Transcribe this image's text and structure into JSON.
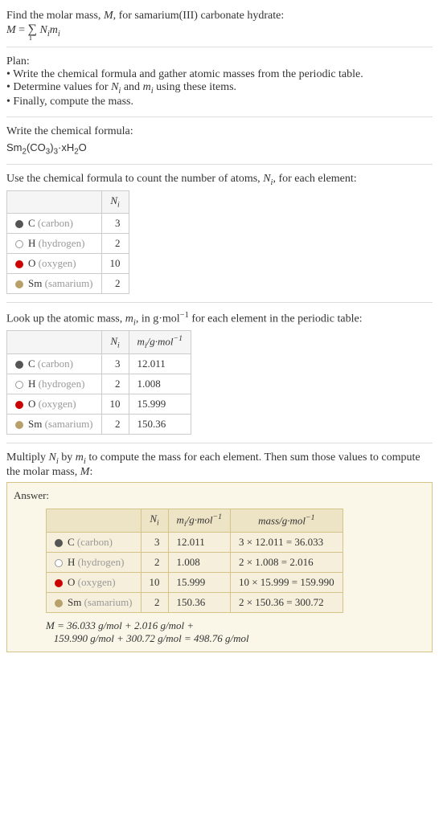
{
  "intro": {
    "line1_part1": "Find the molar mass, ",
    "line1_M": "M",
    "line1_part2": ", for samarium(III) carbonate hydrate:",
    "formula_M": "M",
    "formula_eq": " = ",
    "formula_sum": "∑",
    "formula_sub_i": "i",
    "formula_Ni": "N",
    "formula_Ni_sub": "i",
    "formula_mi": "m",
    "formula_mi_sub": "i"
  },
  "plan": {
    "heading": "Plan:",
    "bullet1": "• Write the chemical formula and gather atomic masses from the periodic table.",
    "bullet2_part1": "• Determine values for ",
    "bullet2_Ni": "N",
    "bullet2_Ni_sub": "i",
    "bullet2_and": " and ",
    "bullet2_mi": "m",
    "bullet2_mi_sub": "i",
    "bullet2_part2": " using these items.",
    "bullet3": "• Finally, compute the mass."
  },
  "formula_section": {
    "heading": "Write the chemical formula:",
    "sm": "Sm",
    "sm_sub": "2",
    "co": "(CO",
    "co_sub3": "3",
    "paren": ")",
    "paren_sub": "3",
    "dot": "·xH",
    "h_sub": "2",
    "o": "O"
  },
  "count_section": {
    "heading_part1": "Use the chemical formula to count the number of atoms, ",
    "heading_Ni": "N",
    "heading_Ni_sub": "i",
    "heading_part2": ", for each element:",
    "header_Ni": "N",
    "header_Ni_sub": "i"
  },
  "elements": [
    {
      "symbol": "C",
      "name": " (carbon)",
      "color": "#555",
      "N": "3",
      "m": "12.011",
      "mass": "3 × 12.011 = 36.033"
    },
    {
      "symbol": "H",
      "name": " (hydrogen)",
      "color": "#fff",
      "border": "#999",
      "N": "2",
      "m": "1.008",
      "mass": "2 × 1.008 = 2.016"
    },
    {
      "symbol": "O",
      "name": " (oxygen)",
      "color": "#c00",
      "N": "10",
      "m": "15.999",
      "mass": "10 × 15.999 = 159.990"
    },
    {
      "symbol": "Sm",
      "name": " (samarium)",
      "color": "#b8a06a",
      "N": "2",
      "m": "150.36",
      "mass": "2 × 150.36 = 300.72"
    }
  ],
  "lookup_section": {
    "heading_part1": "Look up the atomic mass, ",
    "heading_mi": "m",
    "heading_mi_sub": "i",
    "heading_part2": ", in g·mol",
    "heading_sup": "−1",
    "heading_part3": " for each element in the periodic table:",
    "header_mi": "m",
    "header_mi_sub": "i",
    "header_gmol": "/g·mol",
    "header_sup": "−1"
  },
  "multiply_section": {
    "heading_part1": "Multiply ",
    "heading_Ni": "N",
    "heading_Ni_sub": "i",
    "heading_by": " by ",
    "heading_mi": "m",
    "heading_mi_sub": "i",
    "heading_part2": " to compute the mass for each element. Then sum those values to compute the molar mass, ",
    "heading_M": "M",
    "heading_colon": ":"
  },
  "answer": {
    "label": "Answer:",
    "header_mass": "mass/g·mol",
    "header_mass_sup": "−1",
    "final_M": "M",
    "final_eq": " = 36.033 g/mol + 2.016 g/mol + ",
    "final_line2": "159.990 g/mol + 300.72 g/mol = 498.76 g/mol"
  }
}
